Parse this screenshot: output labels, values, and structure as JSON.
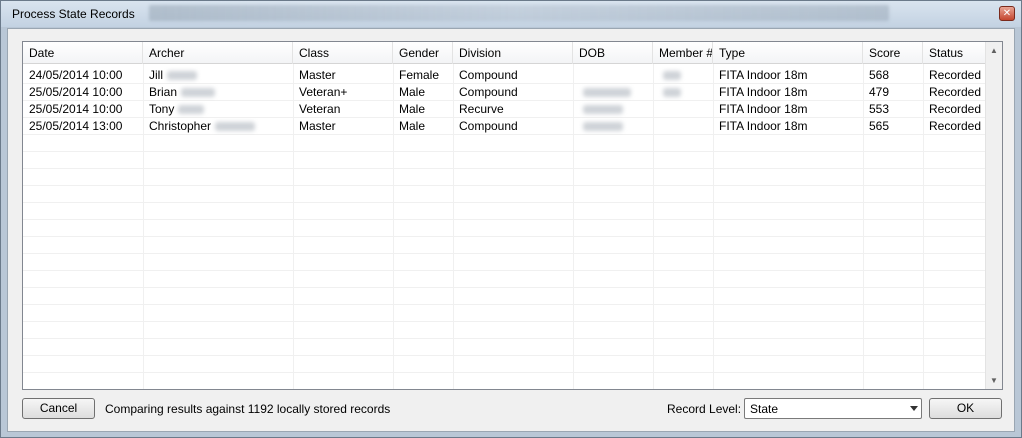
{
  "window": {
    "title": "Process State Records"
  },
  "table": {
    "columns": [
      "Date",
      "Archer",
      "Class",
      "Gender",
      "Division",
      "DOB",
      "Member #",
      "Type",
      "Score",
      "Status"
    ],
    "rows": [
      {
        "date": "24/05/2014 10:00",
        "archer": "Jill",
        "class": "Master",
        "gender": "Female",
        "division": "Compound",
        "type": "FITA Indoor 18m",
        "score": "568",
        "status": "Recorded"
      },
      {
        "date": "25/05/2014 10:00",
        "archer": "Brian",
        "class": "Veteran+",
        "gender": "Male",
        "division": "Compound",
        "type": "FITA Indoor 18m",
        "score": "479",
        "status": "Recorded"
      },
      {
        "date": "25/05/2014 10:00",
        "archer": "Tony",
        "class": "Veteran",
        "gender": "Male",
        "division": "Recurve",
        "type": "FITA Indoor 18m",
        "score": "553",
        "status": "Recorded"
      },
      {
        "date": "25/05/2014 13:00",
        "archer": "Christopher",
        "class": "Master",
        "gender": "Male",
        "division": "Compound",
        "type": "FITA Indoor 18m",
        "score": "565",
        "status": "Recorded"
      }
    ]
  },
  "footer": {
    "cancel_label": "Cancel",
    "status_text": "Comparing results against 1192 locally stored records",
    "record_level_label": "Record Level:",
    "record_level_value": "State",
    "ok_label": "OK"
  }
}
